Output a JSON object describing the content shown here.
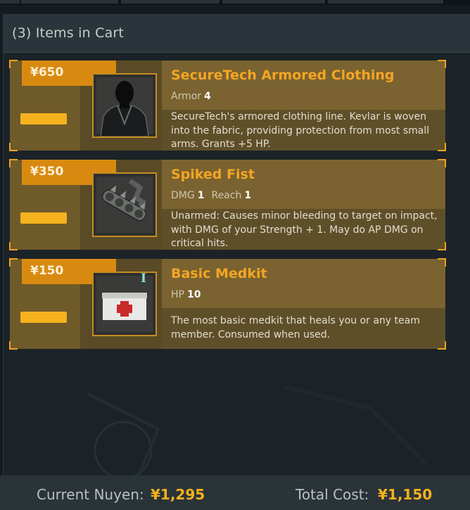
{
  "cart": {
    "title": "(3) Items in Cart"
  },
  "items": [
    {
      "price": "¥650",
      "name": "SecureTech Armored Clothing",
      "stats": [
        {
          "label": "Armor",
          "value": "4"
        }
      ],
      "description": "SecureTech's armored clothing line. Kevlar is woven into the fabric, providing protection from most small arms. Grants +5 HP.",
      "icon": "armored-jacket-icon"
    },
    {
      "price": "¥350",
      "name": "Spiked Fist",
      "stats": [
        {
          "label": "DMG",
          "value": "1"
        },
        {
          "label": "Reach",
          "value": "1"
        }
      ],
      "description": "Unarmed: Causes minor bleeding to target on impact, with DMG of your Strength + 1. May do AP DMG on critical hits.",
      "icon": "spiked-knuckles-icon"
    },
    {
      "price": "¥150",
      "name": "Basic Medkit",
      "tier": "I",
      "stats": [
        {
          "label": "HP",
          "value": "10"
        }
      ],
      "description": "The most basic medkit that heals you or any team member. Consumed when used.",
      "icon": "medkit-icon"
    }
  ],
  "footer": {
    "nuyen_label": "Current Nuyen:",
    "nuyen_value": "¥1,295",
    "total_label": "Total Cost:",
    "total_value": "¥1,150"
  },
  "colors": {
    "accent": "#f5a524",
    "price_tag": "#d88a10",
    "panel": "#1b2328"
  }
}
